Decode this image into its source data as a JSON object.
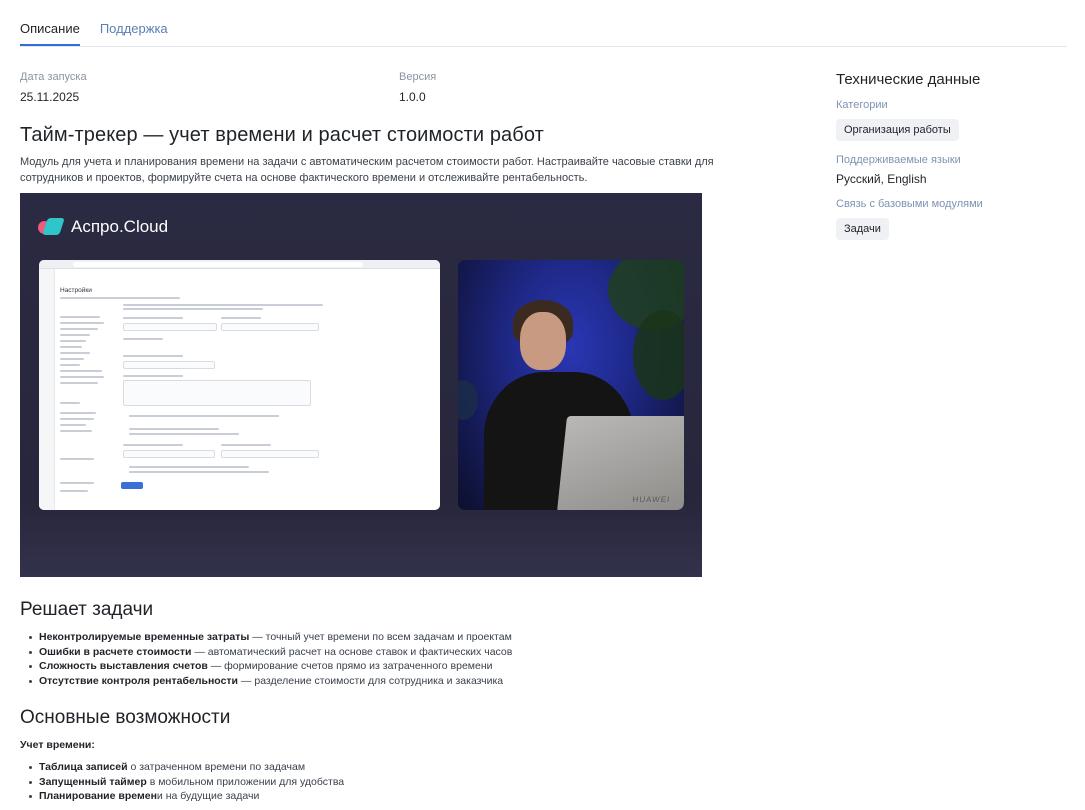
{
  "tabs": [
    {
      "label": "Описание",
      "active": true
    },
    {
      "label": "Поддержка",
      "active": false
    }
  ],
  "meta": {
    "launch_label": "Дата запуска",
    "launch_value": "25.11.2025",
    "version_label": "Версия",
    "version_value": "1.0.0"
  },
  "title": "Тайм-трекер — учет времени и расчет стоимости работ",
  "description": "Модуль для учета и планирования времени на задачи с автоматическим расчетом стоимости работ. Настраивайте часовые ставки для сотрудников и проектов, формируйте счета на основе фактического времени и отслеживайте рентабельность.",
  "video": {
    "logo_text": "Аспро.Cloud",
    "screen_title": "Настройки",
    "laptop_brand": "HUAWEI"
  },
  "problems": {
    "heading": "Решает задачи",
    "items": [
      {
        "bold": "Неконтролируемые временные затраты",
        "rest": " — точный учет времени по всем задачам и проектам"
      },
      {
        "bold": "Ошибки в расчете стоимости",
        "rest": " — автоматический расчет на основе ставок и фактических часов"
      },
      {
        "bold": "Сложность выставления счетов",
        "rest": " — формирование счетов прямо из затраченного времени"
      },
      {
        "bold": "Отсутствие контроля рентабельности",
        "rest": " — разделение стоимости для сотрудника и заказчика"
      }
    ]
  },
  "features": {
    "heading": "Основные возможности",
    "subheading": "Учет времени:",
    "items": [
      {
        "bold": "Таблица записей",
        "rest": " о затраченном времени по задачам"
      },
      {
        "bold": "Запущенный таймер",
        "rest": " в мобильном приложении для удобства"
      },
      {
        "bold": "Планирование времен",
        "rest": "и на будущие задачи"
      }
    ]
  },
  "sidebar": {
    "title": "Технические данные",
    "categories_label": "Категории",
    "category_chip": "Организация работы",
    "languages_label": "Поддерживаемые языки",
    "languages_value": "Русский, English",
    "modules_label": "Связь с базовыми модулями",
    "module_chip": "Задачи"
  },
  "colors": {
    "accent": "#2f6fd6",
    "link": "#5a7fb2",
    "label": "#7f93b2"
  }
}
